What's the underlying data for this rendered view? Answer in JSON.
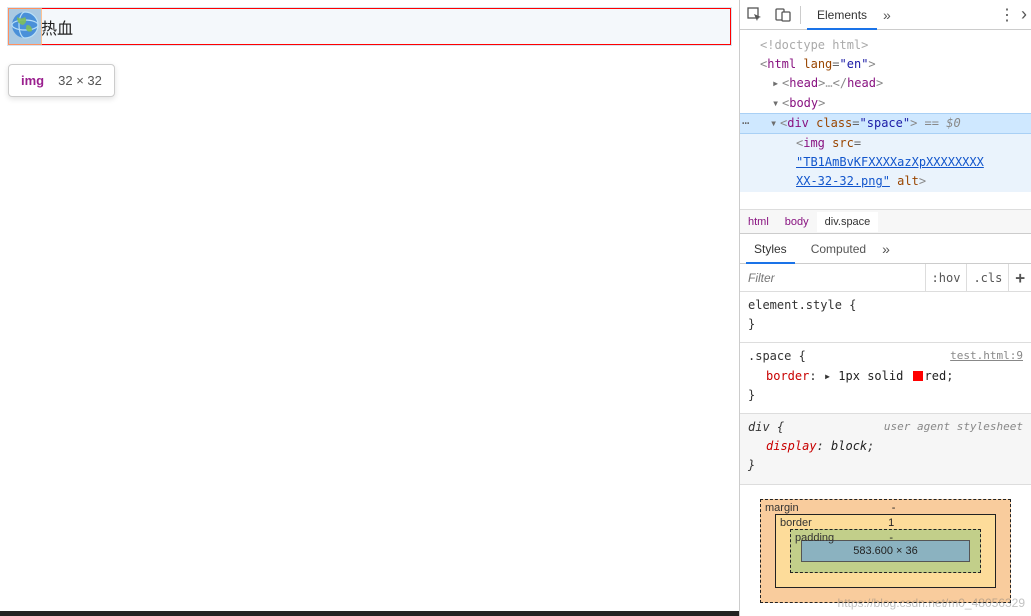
{
  "page": {
    "space_text": "热血"
  },
  "tooltip": {
    "tag": "img",
    "dimensions": "32 × 32"
  },
  "toolbar": {
    "elements_tab": "Elements"
  },
  "dom_tree": {
    "doctype": "<!doctype html>",
    "html_open": "html",
    "html_lang_attr": "lang",
    "html_lang_val": "\"en\"",
    "head_collapsed": "…",
    "head": "head",
    "body": "body",
    "div": "div",
    "div_class_attr": "class",
    "div_class_val": "\"space\"",
    "eq0": " == $0",
    "img": "img",
    "src_attr": "src",
    "src_val1": "\"TB1AmBvKFXXXXazXpXXXXXXXX",
    "src_val2": "XX-32-32.png\"",
    "alt_attr": "alt"
  },
  "breadcrumb": {
    "html": "html",
    "body": "body",
    "div": "div.space"
  },
  "styles_tabs": {
    "styles": "Styles",
    "computed": "Computed"
  },
  "filter": {
    "placeholder": "Filter",
    "hov": ":hov",
    "cls": ".cls",
    "plus": "+"
  },
  "styles": {
    "element_style_sel": "element.style {",
    "close": "}",
    "space_sel": ".space {",
    "space_src": "test.html:9",
    "border_prop": "border",
    "border_tri": "▸",
    "border_val_pre": "1px solid ",
    "border_val_color": "red",
    "semicolon": ";",
    "div_sel": "div {",
    "ua_label": "user agent stylesheet",
    "display_prop": "display",
    "display_val": "block"
  },
  "box": {
    "margin_label": "margin",
    "margin_top": "-",
    "border_label": "border",
    "border_top": "1",
    "padding_label": "padding",
    "padding_top": "-",
    "content": "583.600 × 36"
  },
  "watermark": "https://blog.csdn.net/m0_48056329"
}
